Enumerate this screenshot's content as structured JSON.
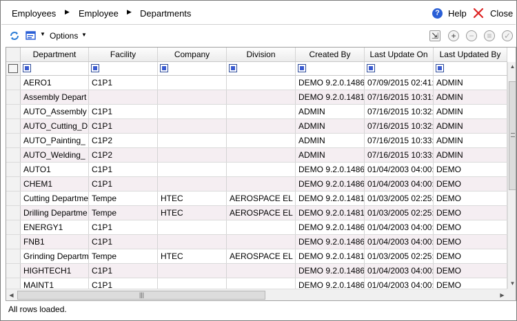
{
  "breadcrumb": [
    "Employees",
    "Employee",
    "Departments"
  ],
  "header": {
    "help_label": "Help",
    "close_label": "Close"
  },
  "toolbar": {
    "options_label": "Options"
  },
  "columns": [
    "Department",
    "Facility",
    "Company",
    "Division",
    "Created By",
    "Last Update On",
    "Last Updated By"
  ],
  "rows": [
    [
      "AERO1",
      "C1P1",
      "",
      "",
      "DEMO 9.2.0.1486",
      "07/09/2015 02:41:",
      "ADMIN"
    ],
    [
      "Assembly Depart",
      "",
      "",
      "",
      "DEMO 9.2.0.1481",
      "07/16/2015 10:31:",
      "ADMIN"
    ],
    [
      "AUTO_Assembly",
      "C1P1",
      "",
      "",
      "ADMIN",
      "07/16/2015 10:32:",
      "ADMIN"
    ],
    [
      "AUTO_Cutting_D",
      "C1P1",
      "",
      "",
      "ADMIN",
      "07/16/2015 10:32:",
      "ADMIN"
    ],
    [
      "AUTO_Painting_",
      "C1P2",
      "",
      "",
      "ADMIN",
      "07/16/2015 10:33:",
      "ADMIN"
    ],
    [
      "AUTO_Welding_",
      "C1P2",
      "",
      "",
      "ADMIN",
      "07/16/2015 10:33:",
      "ADMIN"
    ],
    [
      "AUTO1",
      "C1P1",
      "",
      "",
      "DEMO 9.2.0.1486",
      "01/04/2003 04:00:",
      "DEMO"
    ],
    [
      "CHEM1",
      "C1P1",
      "",
      "",
      "DEMO 9.2.0.1486",
      "01/04/2003 04:00:",
      "DEMO"
    ],
    [
      "Cutting Departme",
      "Tempe",
      "HTEC",
      "AEROSPACE EL",
      "DEMO 9.2.0.1481",
      "01/03/2005 02:25:",
      "DEMO"
    ],
    [
      "Drilling Departme",
      "Tempe",
      "HTEC",
      "AEROSPACE EL",
      "DEMO 9.2.0.1481",
      "01/03/2005 02:25:",
      "DEMO"
    ],
    [
      "ENERGY1",
      "C1P1",
      "",
      "",
      "DEMO 9.2.0.1486",
      "01/04/2003 04:00:",
      "DEMO"
    ],
    [
      "FNB1",
      "C1P1",
      "",
      "",
      "DEMO 9.2.0.1486",
      "01/04/2003 04:00:",
      "DEMO"
    ],
    [
      "Grinding Departm",
      "Tempe",
      "HTEC",
      "AEROSPACE EL",
      "DEMO 9.2.0.1481",
      "01/03/2005 02:25:",
      "DEMO"
    ],
    [
      "HIGHTECH1",
      "C1P1",
      "",
      "",
      "DEMO 9.2.0.1486",
      "01/04/2003 04:00:",
      "DEMO"
    ],
    [
      "MAINT1",
      "C1P1",
      "",
      "",
      "DEMO 9.2.0.1486",
      "01/04/2003 04:00:",
      "DEMO"
    ]
  ],
  "status_text": "All rows loaded."
}
